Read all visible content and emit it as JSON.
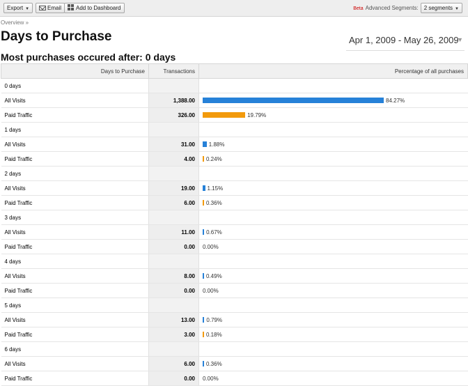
{
  "toolbar": {
    "export_label": "Export",
    "email_label": "Email",
    "dashboard_label": "Add to Dashboard",
    "beta_label": "Beta",
    "segments_label": "Advanced Segments:",
    "segments_value": "2 segments"
  },
  "breadcrumb": "Overview »",
  "page_title": "Days to Purchase",
  "date_range": "Apr 1, 2009 - May 26, 2009",
  "subtitle": "Most purchases occured after: 0 days",
  "table": {
    "headers": [
      "Days to Purchase",
      "Transactions",
      "Percentage of all purchases"
    ],
    "groups": [
      {
        "label": "0 days",
        "rows": [
          {
            "segment": "All Visits",
            "transactions": "1,388.00",
            "percent": "84.27%",
            "pct": 84.27
          },
          {
            "segment": "Paid Traffic",
            "transactions": "326.00",
            "percent": "19.79%",
            "pct": 19.79
          }
        ]
      },
      {
        "label": "1 days",
        "rows": [
          {
            "segment": "All Visits",
            "transactions": "31.00",
            "percent": "1.88%",
            "pct": 1.88
          },
          {
            "segment": "Paid Traffic",
            "transactions": "4.00",
            "percent": "0.24%",
            "pct": 0.24
          }
        ]
      },
      {
        "label": "2 days",
        "rows": [
          {
            "segment": "All Visits",
            "transactions": "19.00",
            "percent": "1.15%",
            "pct": 1.15
          },
          {
            "segment": "Paid Traffic",
            "transactions": "6.00",
            "percent": "0.36%",
            "pct": 0.36
          }
        ]
      },
      {
        "label": "3 days",
        "rows": [
          {
            "segment": "All Visits",
            "transactions": "11.00",
            "percent": "0.67%",
            "pct": 0.67
          },
          {
            "segment": "Paid Traffic",
            "transactions": "0.00",
            "percent": "0.00%",
            "pct": 0
          }
        ]
      },
      {
        "label": "4 days",
        "rows": [
          {
            "segment": "All Visits",
            "transactions": "8.00",
            "percent": "0.49%",
            "pct": 0.49
          },
          {
            "segment": "Paid Traffic",
            "transactions": "0.00",
            "percent": "0.00%",
            "pct": 0
          }
        ]
      },
      {
        "label": "5 days",
        "rows": [
          {
            "segment": "All Visits",
            "transactions": "13.00",
            "percent": "0.79%",
            "pct": 0.79
          },
          {
            "segment": "Paid Traffic",
            "transactions": "3.00",
            "percent": "0.18%",
            "pct": 0.18
          }
        ]
      },
      {
        "label": "6 days",
        "rows": [
          {
            "segment": "All Visits",
            "transactions": "6.00",
            "percent": "0.36%",
            "pct": 0.36
          },
          {
            "segment": "Paid Traffic",
            "transactions": "0.00",
            "percent": "0.00%",
            "pct": 0
          }
        ]
      }
    ]
  },
  "colors": {
    "all_visits": "#2681d8",
    "paid_traffic": "#f29a0c",
    "beta": "#cc0000"
  }
}
